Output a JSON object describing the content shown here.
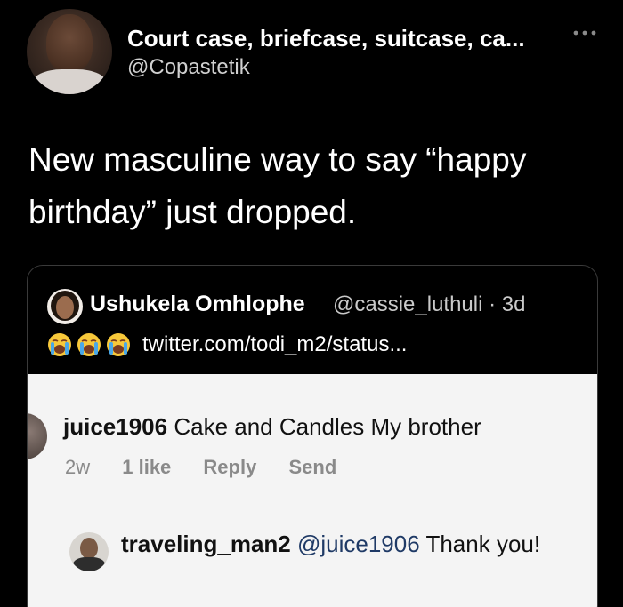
{
  "tweet": {
    "display_name": "Court case, briefcase, suitcase, ca...",
    "handle": "@Copastetik",
    "text": "New masculine way to say “happy birthday” just dropped.",
    "avatar_icon": "user-avatar-photo",
    "more_icon": "more-horizontal-icon"
  },
  "quote": {
    "display_name": "Ushukela Omhlophe",
    "handle_time": "@cassie_luthuli · 3d",
    "emojis": [
      "loudly-crying-face-emoji",
      "loudly-crying-face-emoji",
      "loudly-crying-face-emoji"
    ],
    "link": "twitter.com/todi_m2/status..."
  },
  "embedded": {
    "comment1": {
      "username": "juice1906",
      "text": "Cake and Candles My brother",
      "age": "2w",
      "likes": "1 like",
      "reply_label": "Reply",
      "send_label": "Send"
    },
    "comment2": {
      "username": "traveling_man2",
      "mention": "@juice1906",
      "text": "Thank you!"
    }
  },
  "colors": {
    "background": "#000000",
    "text": "#ffffff",
    "muted": "#c9c9c9",
    "card_border": "#3a3a3a",
    "embedded_bg": "#f4f4f4",
    "meta_gray": "#8a8a8a"
  }
}
